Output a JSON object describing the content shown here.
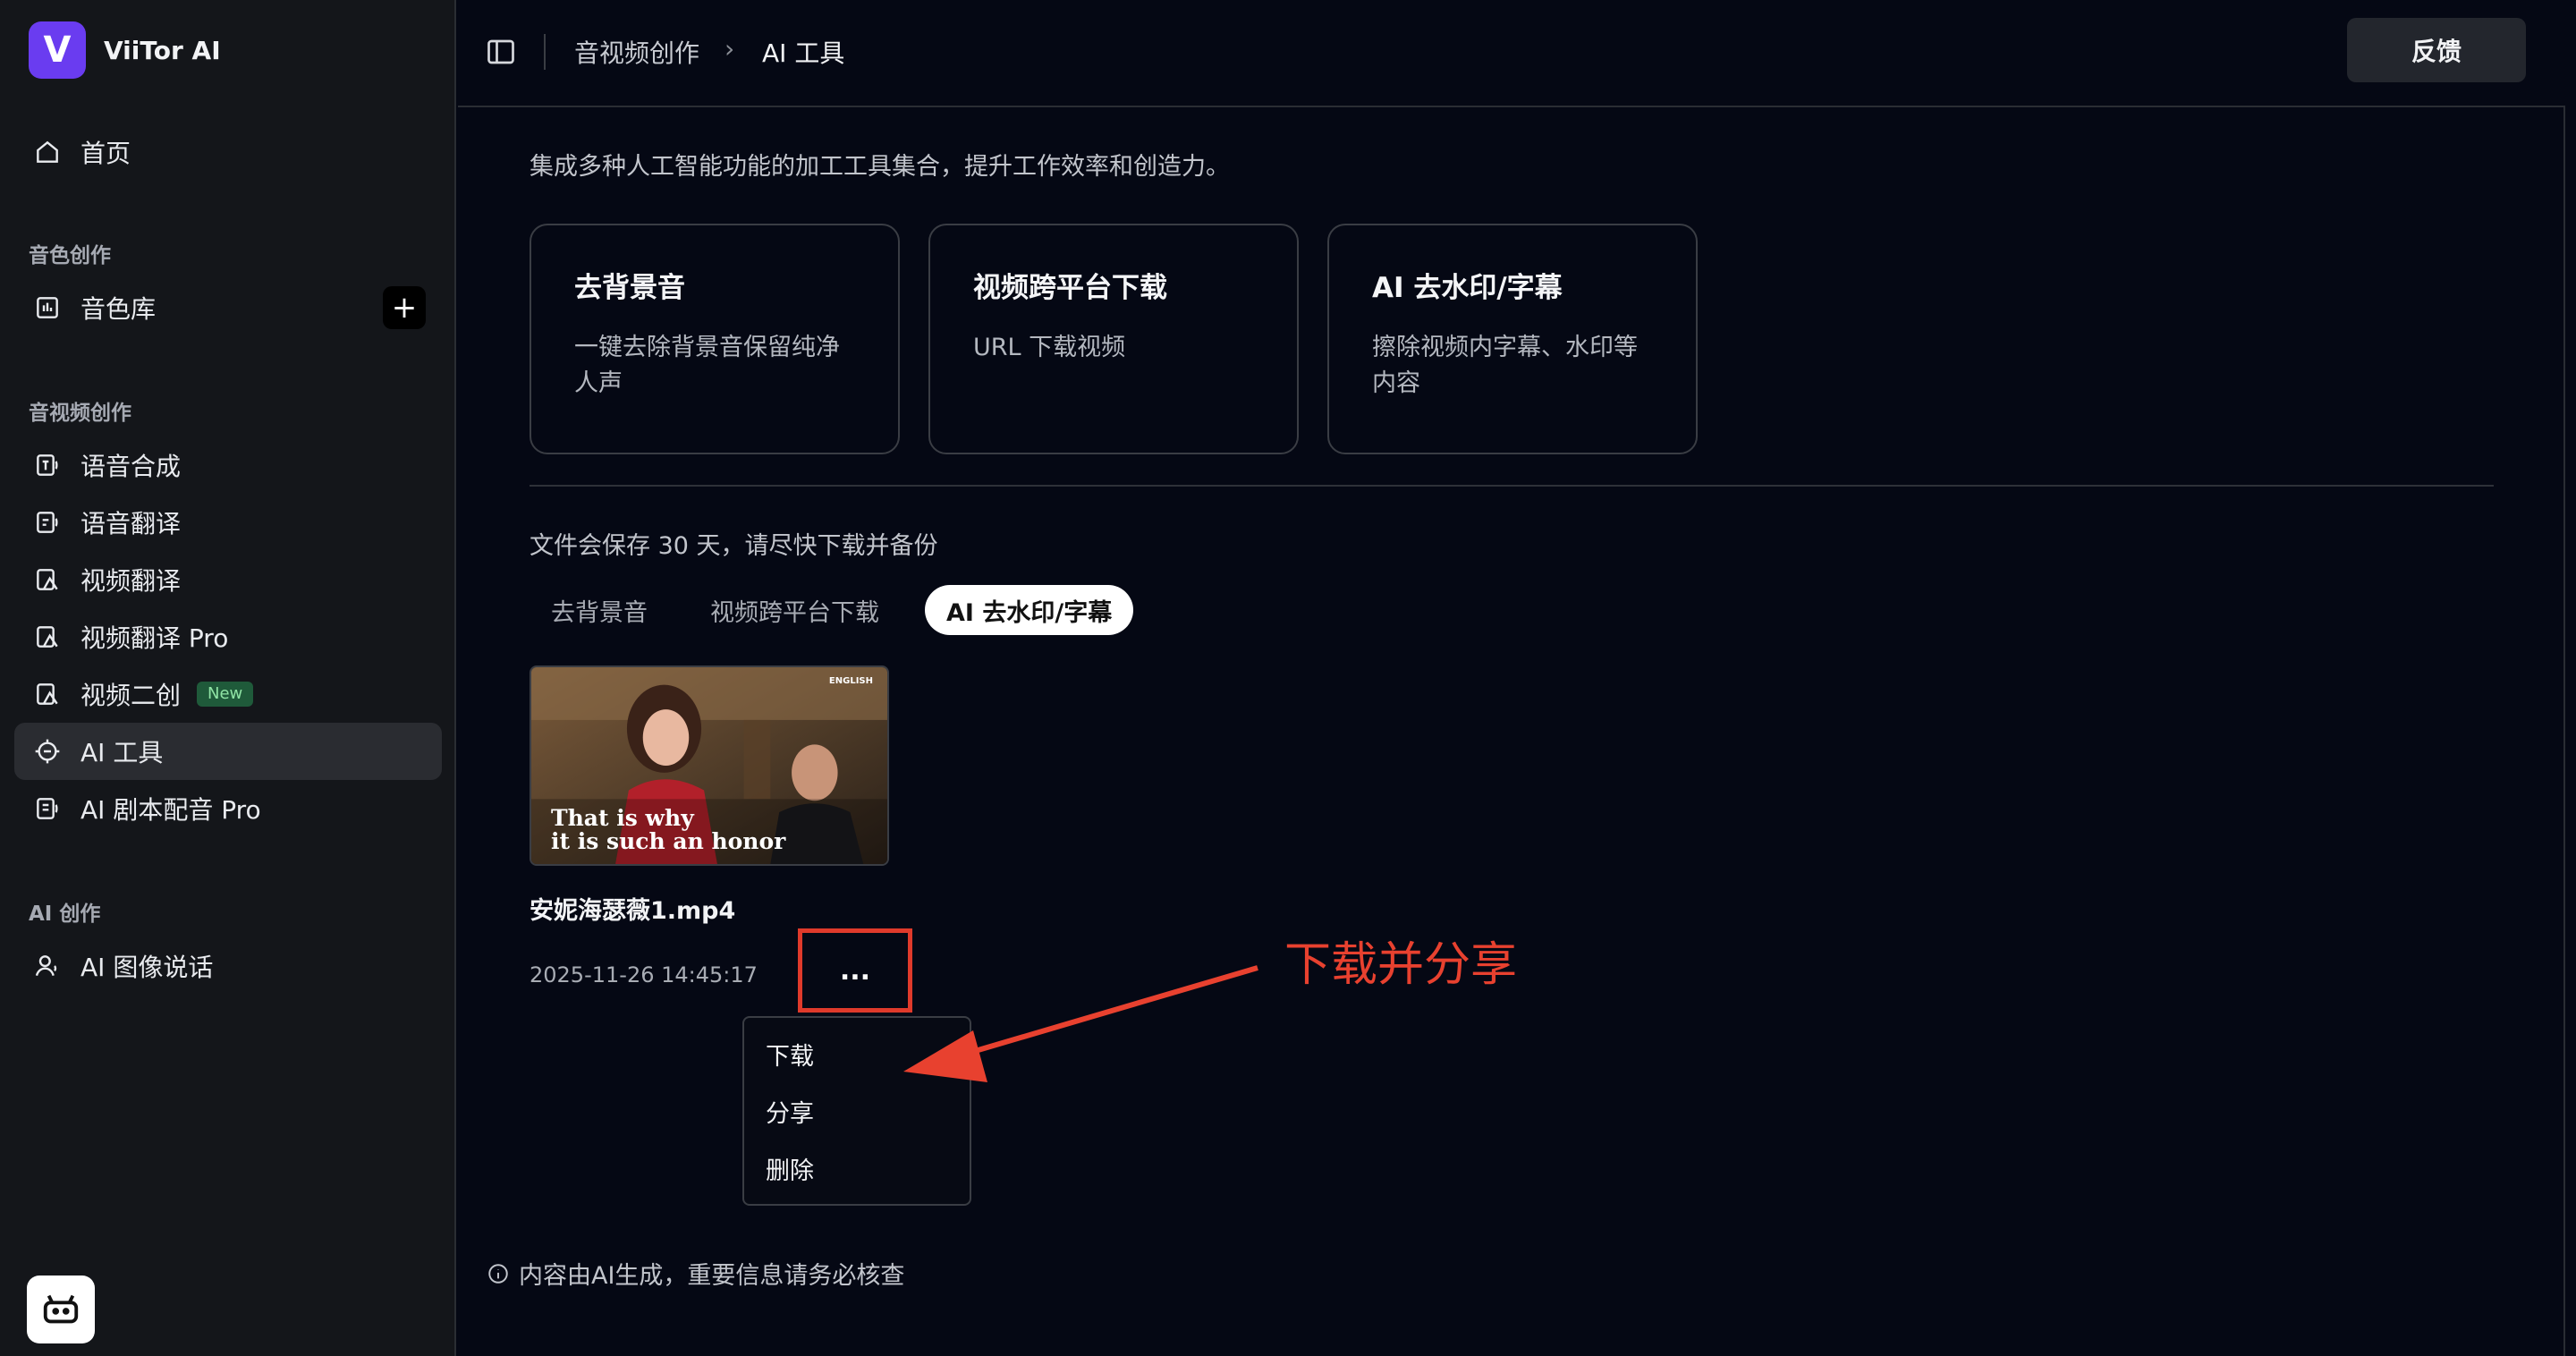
{
  "brand": {
    "name": "ViiTor AI",
    "logo_letter": "V"
  },
  "sidebar": {
    "home": "首页",
    "section_voice": "音色创作",
    "voice_library": "音色库",
    "section_av": "音视频创作",
    "items": [
      {
        "label": "语音合成"
      },
      {
        "label": "语音翻译"
      },
      {
        "label": "视频翻译"
      },
      {
        "label": "视频翻译 Pro"
      },
      {
        "label": "视频二创",
        "badge": "New"
      },
      {
        "label": "AI 工具",
        "active": true
      },
      {
        "label": "AI 剧本配音 Pro"
      }
    ],
    "section_ai": "AI 创作",
    "ai_image_talk": "AI 图像说话"
  },
  "header": {
    "breadcrumb_parent": "音视频创作",
    "breadcrumb_current": "AI 工具",
    "feedback": "反馈"
  },
  "main": {
    "intro": "集成多种人工智能功能的加工工具集合，提升工作效率和创造力。",
    "tools": [
      {
        "title": "去背景音",
        "desc": "一键去除背景音保留纯净人声"
      },
      {
        "title": "视频跨平台下载",
        "desc": "URL 下载视频"
      },
      {
        "title": "AI 去水印/字幕",
        "desc": "擦除视频内字幕、水印等内容"
      }
    ],
    "save_note": "文件会保存 30 天，请尽快下载并备份",
    "tabs": [
      "去背景音",
      "视频跨平台下载",
      "AI 去水印/字幕"
    ],
    "active_tab": "AI 去水印/字幕",
    "file": {
      "name": "安妮海瑟薇1.mp4",
      "date": "2025-11-26 14:45:17",
      "thumb_caption_line1": "That is why",
      "thumb_caption_line2": "it is such an honor",
      "thumb_tag": "ENGLISH",
      "more": "..."
    },
    "menu": [
      "下载",
      "分享",
      "删除"
    ],
    "annotation": "下载并分享",
    "disclaimer": "内容由AI生成，重要信息请务必核查"
  },
  "colors": {
    "accent": "#6a3cf0",
    "annotation": "#e8412f",
    "background": "#050814",
    "sidebar": "#14161a"
  }
}
